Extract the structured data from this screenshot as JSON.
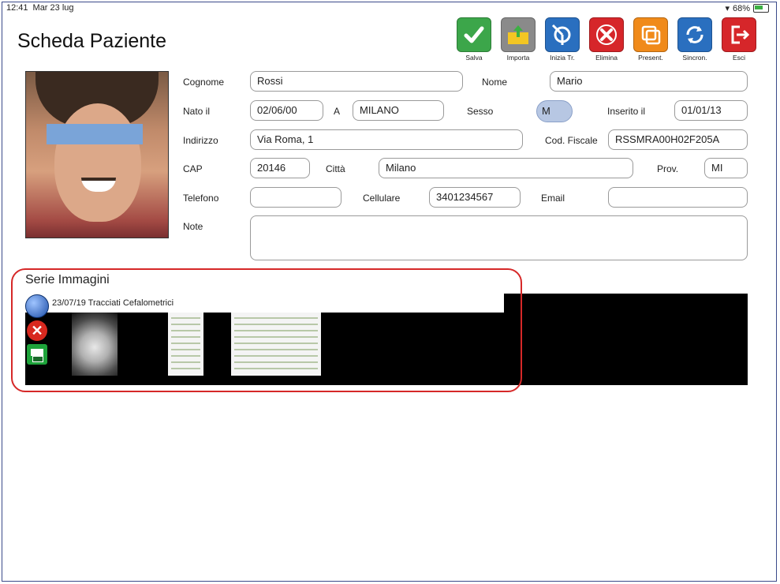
{
  "status_bar": {
    "time": "12:41",
    "date": "Mar 23 lug",
    "battery": "68%"
  },
  "page_title": "Scheda Paziente",
  "toolbar": [
    {
      "id": "salva",
      "label": "Salva",
      "icon": "check-icon",
      "color": "#3ca64a"
    },
    {
      "id": "importa",
      "label": "Importa",
      "icon": "import-folder-icon",
      "color": "#8a8a8a"
    },
    {
      "id": "inizia",
      "label": "Inizia Tr.",
      "icon": "compass-icon",
      "color": "#2a6fbf"
    },
    {
      "id": "elimina",
      "label": "Elimina",
      "icon": "delete-icon",
      "color": "#d6262a"
    },
    {
      "id": "present",
      "label": "Present.",
      "icon": "present-icon",
      "color": "#f08a1a"
    },
    {
      "id": "sincron",
      "label": "Sincron.",
      "icon": "sync-icon",
      "color": "#2a6fbf"
    },
    {
      "id": "esci",
      "label": "Esci",
      "icon": "exit-icon",
      "color": "#d6262a"
    }
  ],
  "form": {
    "cognome_label": "Cognome",
    "cognome": "Rossi",
    "nome_label": "Nome",
    "nome": "Mario",
    "nato_label": "Nato il",
    "nato": "02/06/00",
    "a_label": "A",
    "luogo": "MILANO",
    "sesso_label": "Sesso",
    "sesso": "M",
    "inserito_label": "Inserito il",
    "inserito": "01/01/13",
    "indirizzo_label": "Indirizzo",
    "indirizzo": "Via Roma, 1",
    "codfiscale_label": "Cod. Fiscale",
    "codfiscale": "RSSMRA00H02F205A",
    "cap_label": "CAP",
    "cap": "20146",
    "citta_label": "Città",
    "citta": "Milano",
    "prov_label": "Prov.",
    "prov": "MI",
    "telefono_label": "Telefono",
    "telefono": "",
    "cellulare_label": "Cellulare",
    "cellulare": "3401234567",
    "email_label": "Email",
    "email": "",
    "note_label": "Note",
    "note": ""
  },
  "series": {
    "title": "Serie Immagini",
    "item_label": "23/07/19 Tracciati Cefalometrici"
  }
}
